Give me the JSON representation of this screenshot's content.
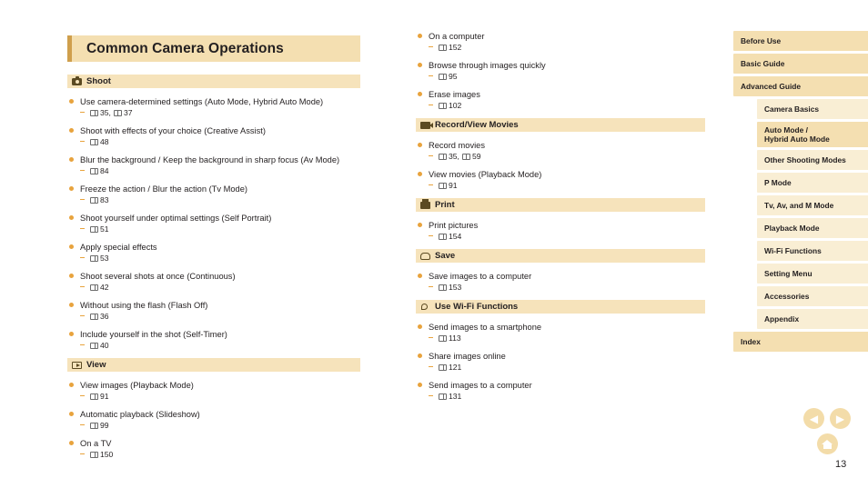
{
  "page": {
    "title": "Common Camera Operations",
    "page_number": "13"
  },
  "left_column": {
    "sections": [
      {
        "icon": "camera-icon",
        "label": "Shoot",
        "entries": [
          {
            "text": "Use camera-determined settings (Auto Mode, Hybrid Auto Mode)",
            "refs": [
              "35",
              "37"
            ]
          },
          {
            "text": "Shoot with effects of your choice (Creative Assist)",
            "refs": [
              "48"
            ]
          },
          {
            "text": "Blur the background / Keep the background in sharp focus (Av Mode)",
            "refs": [
              "84"
            ]
          },
          {
            "text": "Freeze the action / Blur the action (Tv Mode)",
            "refs": [
              "83"
            ]
          },
          {
            "text": "Shoot yourself under optimal settings (Self Portrait)",
            "refs": [
              "51"
            ]
          },
          {
            "text": "Apply special effects",
            "refs": [
              "53"
            ]
          },
          {
            "text": "Shoot several shots at once (Continuous)",
            "refs": [
              "42"
            ]
          },
          {
            "text": "Without using the flash (Flash Off)",
            "refs": [
              "36"
            ]
          },
          {
            "text": "Include yourself in the shot (Self-Timer)",
            "refs": [
              "40"
            ]
          }
        ]
      },
      {
        "icon": "play-icon",
        "label": "View",
        "entries": [
          {
            "text": "View images (Playback Mode)",
            "refs": [
              "91"
            ]
          },
          {
            "text": "Automatic playback (Slideshow)",
            "refs": [
              "99"
            ]
          },
          {
            "text": "On a TV",
            "refs": [
              "150"
            ]
          }
        ]
      }
    ]
  },
  "middle_column": {
    "sections": [
      {
        "icon": "none",
        "label": "",
        "entries": [
          {
            "text": "On a computer",
            "refs": [
              "152"
            ]
          },
          {
            "text": "Browse through images quickly",
            "refs": [
              "95"
            ]
          },
          {
            "text": "Erase images",
            "refs": [
              "102"
            ]
          }
        ]
      },
      {
        "icon": "movie-icon",
        "label": "Record/View Movies",
        "entries": [
          {
            "text": "Record movies",
            "refs": [
              "35",
              "59"
            ]
          },
          {
            "text": "View movies (Playback Mode)",
            "refs": [
              "91"
            ]
          }
        ]
      },
      {
        "icon": "print-icon",
        "label": "Print",
        "entries": [
          {
            "text": "Print pictures",
            "refs": [
              "154"
            ]
          }
        ]
      },
      {
        "icon": "save-icon",
        "label": "Save",
        "entries": [
          {
            "text": "Save images to a computer",
            "refs": [
              "153"
            ]
          }
        ]
      },
      {
        "icon": "wifi-icon",
        "label": "Use Wi-Fi Functions",
        "entries": [
          {
            "text": "Send images to a smartphone",
            "refs": [
              "113"
            ]
          },
          {
            "text": "Share images online",
            "refs": [
              "121"
            ]
          },
          {
            "text": "Send images to a computer",
            "refs": [
              "131"
            ]
          }
        ]
      }
    ]
  },
  "nav": {
    "items": [
      {
        "label": "Before Use",
        "level": "top",
        "active": false
      },
      {
        "label": "Basic Guide",
        "level": "top",
        "active": false
      },
      {
        "label": "Advanced Guide",
        "level": "top",
        "active": false
      },
      {
        "label": "Camera Basics",
        "level": "sub",
        "active": false
      },
      {
        "label": "Auto Mode /\nHybrid Auto Mode",
        "level": "sub",
        "active": true,
        "two_line": true
      },
      {
        "label": "Other Shooting Modes",
        "level": "sub",
        "active": false
      },
      {
        "label": "P Mode",
        "level": "sub",
        "active": false
      },
      {
        "label": "Tv, Av, and M Mode",
        "level": "sub",
        "active": false
      },
      {
        "label": "Playback Mode",
        "level": "sub",
        "active": false
      },
      {
        "label": "Wi-Fi Functions",
        "level": "sub",
        "active": false
      },
      {
        "label": "Setting Menu",
        "level": "sub",
        "active": false
      },
      {
        "label": "Accessories",
        "level": "sub",
        "active": false
      },
      {
        "label": "Appendix",
        "level": "sub",
        "active": false
      },
      {
        "label": "Index",
        "level": "top",
        "active": false
      }
    ]
  },
  "controls": {
    "prev_label": "◀",
    "next_label": "▶",
    "home_label": "home-icon"
  }
}
